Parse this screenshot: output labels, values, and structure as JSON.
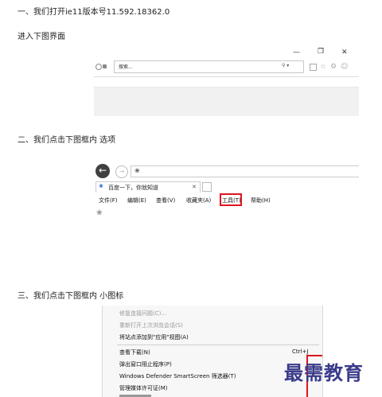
{
  "doc": {
    "step1": "一、我们打开ie11版本号11.592.18362.0",
    "step1_sub": "进入下图界面",
    "step2": "二、我们点击下图框内 选项",
    "step3": "三、我们点击下图框内 小图标"
  },
  "shot1": {
    "min_glyph": "—",
    "max_glyph": "❐",
    "close_glyph": "✕",
    "search_placeholder": "搜索...",
    "search_glyph": "⚲ ▾"
  },
  "shot2": {
    "tab_label": "百度一下，你就知道",
    "menus": [
      "文件(F)",
      "编辑(E)",
      "查看(V)",
      "收藏夹(A)",
      "工具(T)",
      "帮助(H)"
    ],
    "highlight_color": "#e0141e"
  },
  "shot3": {
    "items": [
      "修复连接问题(C)...",
      "重新打开上次浏览会话(S)",
      "将站点添加到\"应用\"视图(A)",
      "查看下载(N)",
      "弹出窗口阻止程序(P)",
      "Windows Defender SmartScreen 筛选器(T)",
      "管理媒体许可证(M)"
    ],
    "shortcut": "Ctrl+J"
  },
  "watermark": "最需教育"
}
